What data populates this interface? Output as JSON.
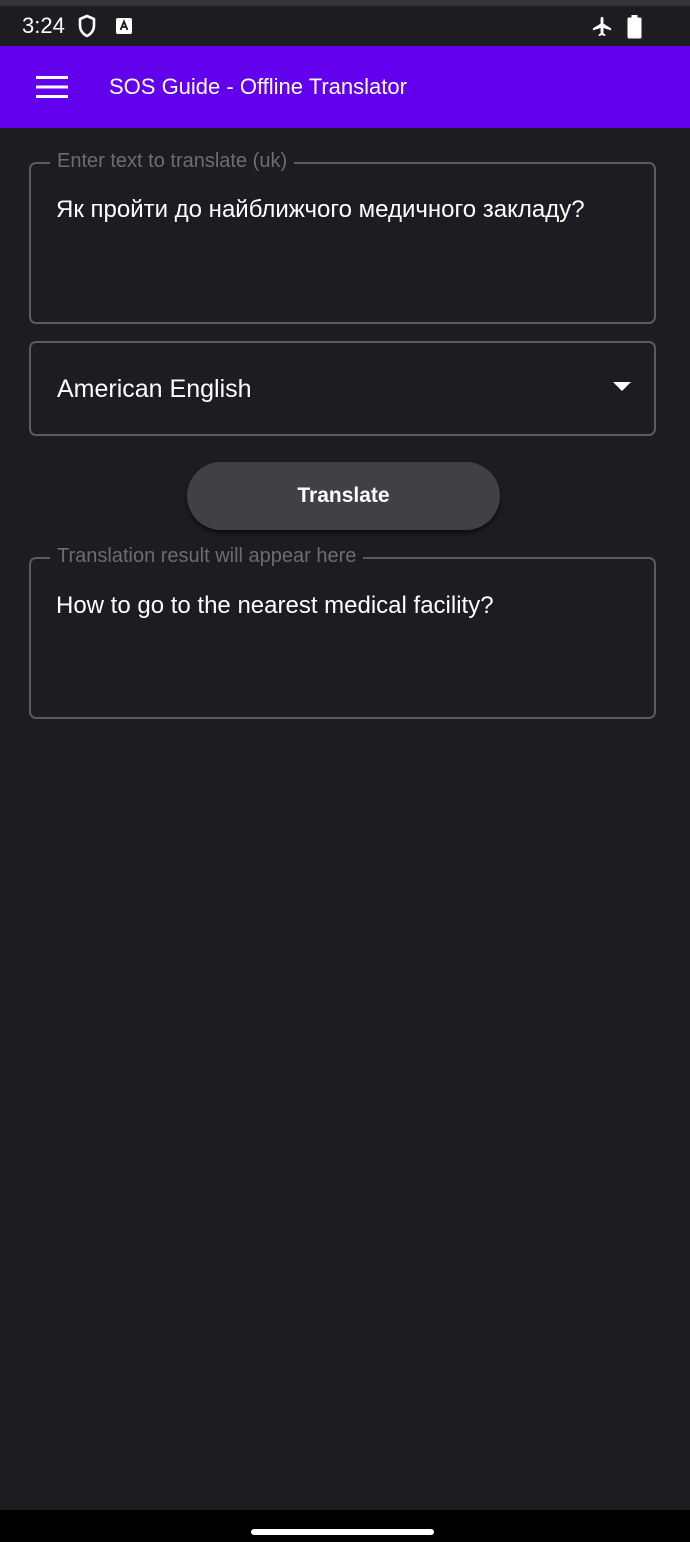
{
  "status_bar": {
    "time": "3:24",
    "icons": [
      "shield-icon",
      "accessibility-a-icon",
      "airplane-icon",
      "battery-icon"
    ]
  },
  "app_bar": {
    "menu_icon": "hamburger-menu-icon",
    "title": "SOS Guide - Offline Translator",
    "background_color": "#6200ee"
  },
  "translator": {
    "source": {
      "label": "Enter text to translate (uk)",
      "value": "Як пройти до найближчого медичного закладу?"
    },
    "target_language": {
      "selected": "American English",
      "arrow_icon": "dropdown-arrow-icon"
    },
    "translate_button": {
      "label": "Translate"
    },
    "result": {
      "label": "Translation result will appear here",
      "value": "How to go to the nearest medical facility?"
    }
  },
  "navigation": {
    "home_handle": "home-gesture-handle"
  }
}
